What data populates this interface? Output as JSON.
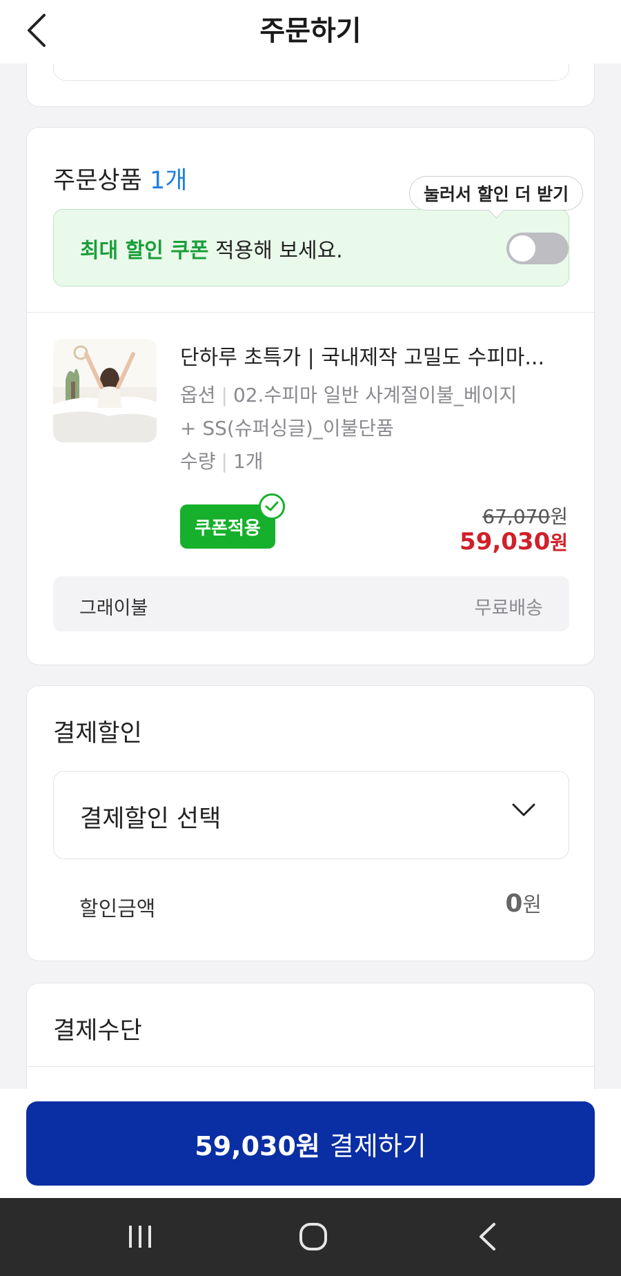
{
  "header": {
    "title": "주문하기"
  },
  "order_items": {
    "title_prefix": "주문상품",
    "title_count": "1개",
    "tooltip": "눌러서 할인 더 받기",
    "coupon_banner": {
      "highlight": "최대 할인 쿠폰",
      "rest": " 적용해 보세요.",
      "toggle_on": false
    },
    "product": {
      "name": "단하루 초특가 | 국내제작 고밀도 수피마...",
      "option_label": "옵션",
      "option_value_line1": "02.수피마 일반 사계절이불_베이지",
      "option_value_line2": "+ SS(슈퍼싱글)_이불단품",
      "qty_label": "수량",
      "qty_value": "1개",
      "coupon_badge": "쿠폰적용",
      "original_price": "67,070",
      "original_unit": "원",
      "sale_price": "59,030",
      "sale_unit": "원"
    },
    "shipping": {
      "seller": "그래이불",
      "fee": "무료배송"
    }
  },
  "payment_discount": {
    "title": "결제할인",
    "select_label": "결제할인 선택",
    "amount_label": "할인금액",
    "amount_value": "0",
    "amount_unit": "원"
  },
  "payment_method": {
    "title": "결제수단"
  },
  "pay_button": {
    "amount": "59,030원",
    "label": "결제하기"
  },
  "colors": {
    "accent_blue": "#1e7fe0",
    "coupon_green": "#16b02c",
    "sale_red": "#d0202a",
    "pay_button": "#0a2ea3"
  }
}
